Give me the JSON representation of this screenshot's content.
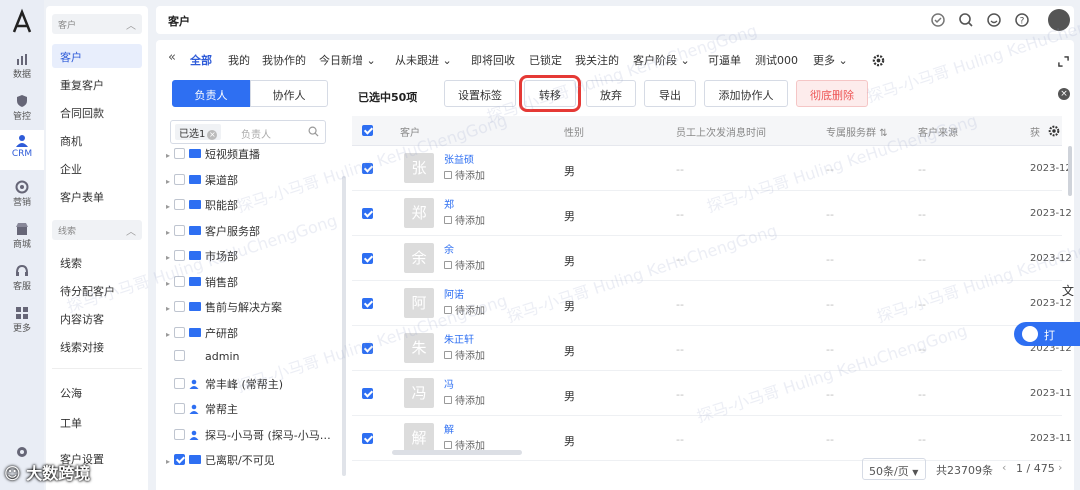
{
  "leftbar": {
    "items": [
      {
        "label": "数据",
        "icon": "chart-icon"
      },
      {
        "label": "管控",
        "icon": "shield-icon"
      },
      {
        "label": "CRM",
        "icon": "person-icon"
      },
      {
        "label": "营销",
        "icon": "target-icon"
      },
      {
        "label": "商城",
        "icon": "shop-icon"
      },
      {
        "label": "客服",
        "icon": "headset-icon"
      },
      {
        "label": "更多",
        "icon": "grid-icon"
      }
    ]
  },
  "sidebar": {
    "group1": "客户",
    "items1": [
      "客户",
      "重复客户",
      "合同回款",
      "商机",
      "企业",
      "客户表单"
    ],
    "group2": "线索",
    "items2": [
      "线索",
      "待分配客户",
      "内容访客",
      "线索对接"
    ],
    "items3": [
      "公海",
      "工单",
      "客户设置"
    ]
  },
  "topbar": {
    "title": "客户"
  },
  "filters": [
    "全部",
    "我的",
    "我协作的",
    "今日新增",
    "从未跟进",
    "即将回收",
    "已锁定",
    "我关注的",
    "客户阶段",
    "可逼单",
    "测试000",
    "更多"
  ],
  "seg": {
    "owner": "负责人",
    "collab": "协作人"
  },
  "search": {
    "chip": "已选1",
    "placeholder": "负责人"
  },
  "tree": [
    "短视频直播",
    "渠道部",
    "职能部",
    "客户服务部",
    "市场部",
    "销售部",
    "售前与解决方案",
    "产研部",
    "admin",
    "常丰峰 (常帮主)",
    "常帮主",
    "探马-小马哥 (探马-小马…",
    "已离职/不可见"
  ],
  "toolbar": {
    "selected": "已选中50项",
    "set_tag": "设置标签",
    "transfer": "转移",
    "abandon": "放弃",
    "export": "导出",
    "add_collab": "添加协作人",
    "delete": "彻底删除"
  },
  "columns": [
    "客户",
    "性别",
    "员工上次发消息时间",
    "专属服务群",
    "客户来源",
    "获"
  ],
  "rows": [
    {
      "char": "张",
      "name": "张益硕",
      "tag": "待添加",
      "gender": "男",
      "date": "2023-12"
    },
    {
      "char": "郑",
      "name": "郑",
      "tag": "待添加",
      "gender": "男",
      "date": "2023-12"
    },
    {
      "char": "余",
      "name": "余",
      "tag": "待添加",
      "gender": "男",
      "date": "2023-12"
    },
    {
      "char": "阿",
      "name": "阿诺",
      "tag": "待添加",
      "gender": "男",
      "date": "2023-12"
    },
    {
      "char": "朱",
      "name": "朱正轩",
      "tag": "待添加",
      "gender": "男",
      "date": "2023-12"
    },
    {
      "char": "冯",
      "name": "冯",
      "tag": "待添加",
      "gender": "男",
      "date": "2023-11"
    },
    {
      "char": "解",
      "name": "解",
      "tag": "待添加",
      "gender": "男",
      "date": "2023-11"
    }
  ],
  "dash": "--",
  "footer": {
    "page_size": "50条/页",
    "total": "共23709条",
    "page": "1 / 475"
  },
  "float_btn": "打",
  "brand": "大数跨境",
  "watermark": "探马-小马哥 Huling KeHuChengGong"
}
